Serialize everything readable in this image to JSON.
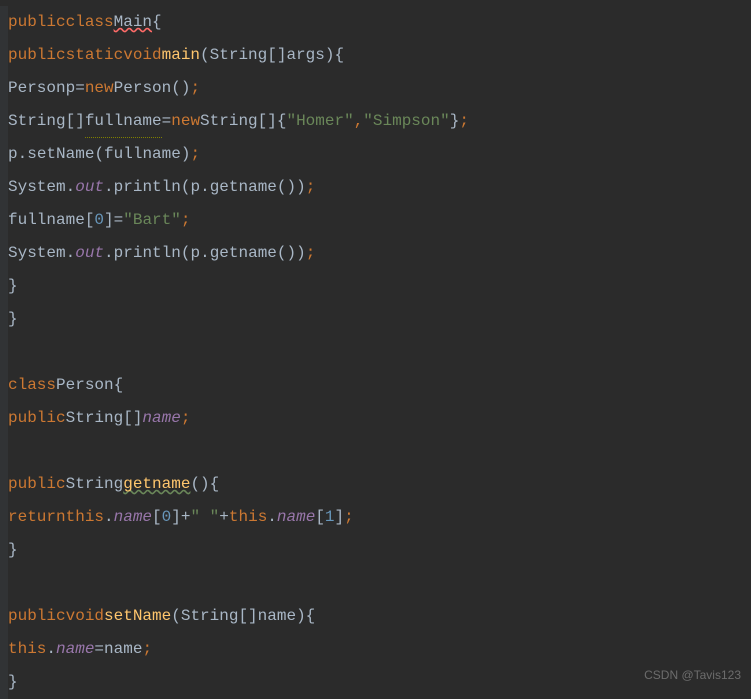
{
  "code": {
    "line1": {
      "kw_public": "public",
      "kw_class": "class",
      "class_main": "Main",
      "brace": "{"
    },
    "line2": {
      "kw_public": "public",
      "kw_static": "static",
      "kw_void": "void",
      "method_main": "main",
      "type_string": "String",
      "brackets": "[]",
      "param_args": "args",
      "paren_close": ")",
      "brace": "{"
    },
    "line3": {
      "type_person": "Person",
      "var_p": "p",
      "eq": "=",
      "kw_new": "new",
      "ctor_person": "Person",
      "call": "()",
      "semi": ";"
    },
    "line4": {
      "type_string": "String",
      "brackets": "[]",
      "var_fullname": "fullname",
      "eq": "=",
      "kw_new": "new",
      "type_string2": "String",
      "brackets2": "[]",
      "brace_open": "{",
      "str_homer": "\"Homer\"",
      "comma": ",",
      "str_simpson": "\"Simpson\"",
      "brace_close": "}",
      "semi": ";"
    },
    "line5": {
      "var_p": "p",
      "dot": ".",
      "method_setname": "setName",
      "paren_open": "(",
      "var_fullname": "fullname",
      "paren_close": ")",
      "semi": ";"
    },
    "line6": {
      "class_system": "System",
      "dot1": ".",
      "field_out": "out",
      "dot2": ".",
      "method_println": "println",
      "paren_open": "(",
      "var_p": "p",
      "dot3": ".",
      "method_getname": "getname",
      "call": "()",
      "paren_close": ")",
      "semi": ";"
    },
    "line7": {
      "var_fullname": "fullname",
      "bracket_open": "[",
      "num_0": "0",
      "bracket_close": "]",
      "eq": "=",
      "str_bart": "\"Bart\"",
      "semi": ";"
    },
    "line8": {
      "class_system": "System",
      "dot1": ".",
      "field_out": "out",
      "dot2": ".",
      "method_println": "println",
      "paren_open": "(",
      "var_p": "p",
      "dot3": ".",
      "method_getname": "getname",
      "call": "()",
      "paren_close": ")",
      "semi": ";"
    },
    "line9": {
      "brace": "}"
    },
    "line10": {
      "brace": "}"
    },
    "line12": {
      "kw_class": "class",
      "class_person": "Person",
      "brace": "{"
    },
    "line13": {
      "kw_public": "public",
      "type_string": "String",
      "brackets": "[]",
      "field_name": "name",
      "semi": ";"
    },
    "line15": {
      "kw_public": "public",
      "type_string": "String",
      "method_getname": "getname",
      "call": "()",
      "brace": "{"
    },
    "line16": {
      "kw_return": "return",
      "kw_this": "this",
      "dot1": ".",
      "field_name": "name",
      "bracket_open": "[",
      "num_0": "0",
      "bracket_close": "]",
      "plus1": "+",
      "str_space": "\" \"",
      "plus2": "+",
      "kw_this2": "this",
      "dot2": ".",
      "field_name2": "name",
      "bracket_open2": "[",
      "num_1": "1",
      "bracket_close2": "]",
      "semi": ";"
    },
    "line17": {
      "brace": "}"
    },
    "line19": {
      "kw_public": "public",
      "kw_void": "void",
      "method_setname": "setName",
      "paren_open": "(",
      "type_string": "String",
      "brackets": "[]",
      "param_name": "name",
      "paren_close": ")",
      "brace": "{"
    },
    "line20": {
      "kw_this": "this",
      "dot": ".",
      "field_name": "name",
      "eq": "=",
      "var_name": "name",
      "semi": ";"
    },
    "line21": {
      "brace": "}"
    }
  },
  "watermark": "CSDN @Tavis123"
}
